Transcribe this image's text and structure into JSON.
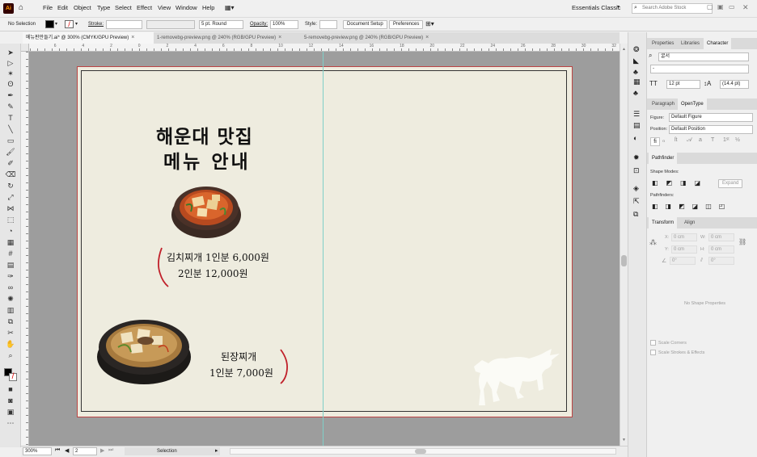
{
  "app": {
    "logo": "Ai"
  },
  "menu": [
    "File",
    "Edit",
    "Object",
    "Type",
    "Select",
    "Effect",
    "View",
    "Window",
    "Help"
  ],
  "workspace": {
    "name": "Essentials Classic",
    "search_placeholder": "Search Adobe Stock"
  },
  "control_bar": {
    "selection": "No Selection",
    "stroke_label": "Stroke:",
    "brush": "5 pt. Round",
    "opacity_label": "Opacity:",
    "opacity_value": "100%",
    "style_label": "Style:",
    "document_setup": "Document Setup",
    "preferences": "Preferences"
  },
  "tabs": [
    {
      "label": "메뉴판만들기.ai* @ 300% (CMYK/GPU Preview)",
      "active": true
    },
    {
      "label": "1-removebg-preview.png @ 240% (RGB/GPU Preview)",
      "active": false
    },
    {
      "label": "5-removebg-preview.png @ 240% (RGB/GPU Preview)",
      "active": false
    }
  ],
  "ruler": [
    "8",
    "7",
    "6",
    "5",
    "4",
    "3",
    "2",
    "1",
    "0",
    "1",
    "2",
    "3",
    "4",
    "5",
    "6",
    "7",
    "8",
    "9",
    "10",
    "11",
    "12",
    "13",
    "14",
    "15",
    "16",
    "17",
    "18",
    "19",
    "20",
    "21",
    "22",
    "23",
    "24",
    "25",
    "26",
    "27",
    "28",
    "29",
    "30",
    "31",
    "32"
  ],
  "artboard": {
    "title_line1": "해운대 맛집",
    "title_line2": "메뉴 안내",
    "item1_name_price": "김치찌개 1인분 6,000원",
    "item1_price2": "2인분 12,000원",
    "item2_name": "된장찌개",
    "item2_price": "1인분 7,000원"
  },
  "status": {
    "zoom": "300%",
    "page": "2",
    "mode": "Selection"
  },
  "panels": {
    "tabs_top": [
      "Properties",
      "Libraries",
      "Character"
    ],
    "font_family": "굴서",
    "font_style": "-",
    "font_size": "12 pt",
    "leading": "(14.4 pt)",
    "tabs_mid": [
      "Paragraph",
      "OpenType"
    ],
    "figure_label": "Figure:",
    "figure_value": "Default Figure",
    "position_label": "Position:",
    "position_value": "Default Position",
    "pathfinder_tab": "Pathfinder",
    "shape_modes": "Shape Modes:",
    "expand": "Expand",
    "pathfinders": "Pathfinders:",
    "tabs_bottom": [
      "Transform",
      "Align"
    ],
    "x_label": "X:",
    "y_label": "Y:",
    "w_label": "W:",
    "h_label": "H:",
    "x_value": "0 cm",
    "y_value": "0 cm",
    "w_value": "0 cm",
    "h_value": "0 cm",
    "angle_value": "0°",
    "shear_value": "0°",
    "no_shape": "No Shape Properties",
    "scale_corners": "Scale Corners",
    "scale_strokes": "Scale Strokes & Effects"
  }
}
